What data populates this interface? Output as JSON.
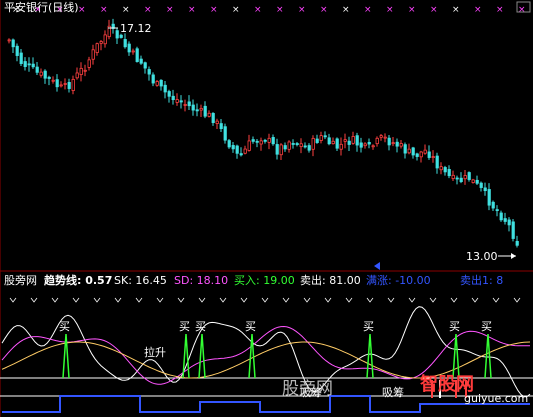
{
  "window": {
    "title": "平安银行(日线)"
  },
  "price_panel": {
    "high_label": "17.12",
    "low_label": "13.00"
  },
  "indicator_bar": {
    "name": "股旁网",
    "items": [
      {
        "label": "趋势线:",
        "value": "0.57",
        "color": "#ffffff"
      },
      {
        "label": "SK:",
        "value": "16.45",
        "color": "#ffffff"
      },
      {
        "label": "SD:",
        "value": "18.10",
        "color": "#ff55ff"
      },
      {
        "label": "买入:",
        "value": "19.00",
        "color": "#33ff33"
      },
      {
        "label": "卖出:",
        "value": "81.00",
        "color": "#ffffff"
      },
      {
        "label": "满涨:",
        "value": "-10.00",
        "color": "#3355ff"
      },
      {
        "label": "卖出1:",
        "value": "8",
        "color": "#3355ff"
      }
    ]
  },
  "annotations": {
    "buy": "买",
    "rise": "拉升",
    "absorb": "吸筹",
    "absorb2": "吸筹"
  },
  "watermark": {
    "text": "股旁网",
    "brand": "智股网",
    "url": "guiyue.com",
    "brand_color": "#ff3b3b"
  }
}
